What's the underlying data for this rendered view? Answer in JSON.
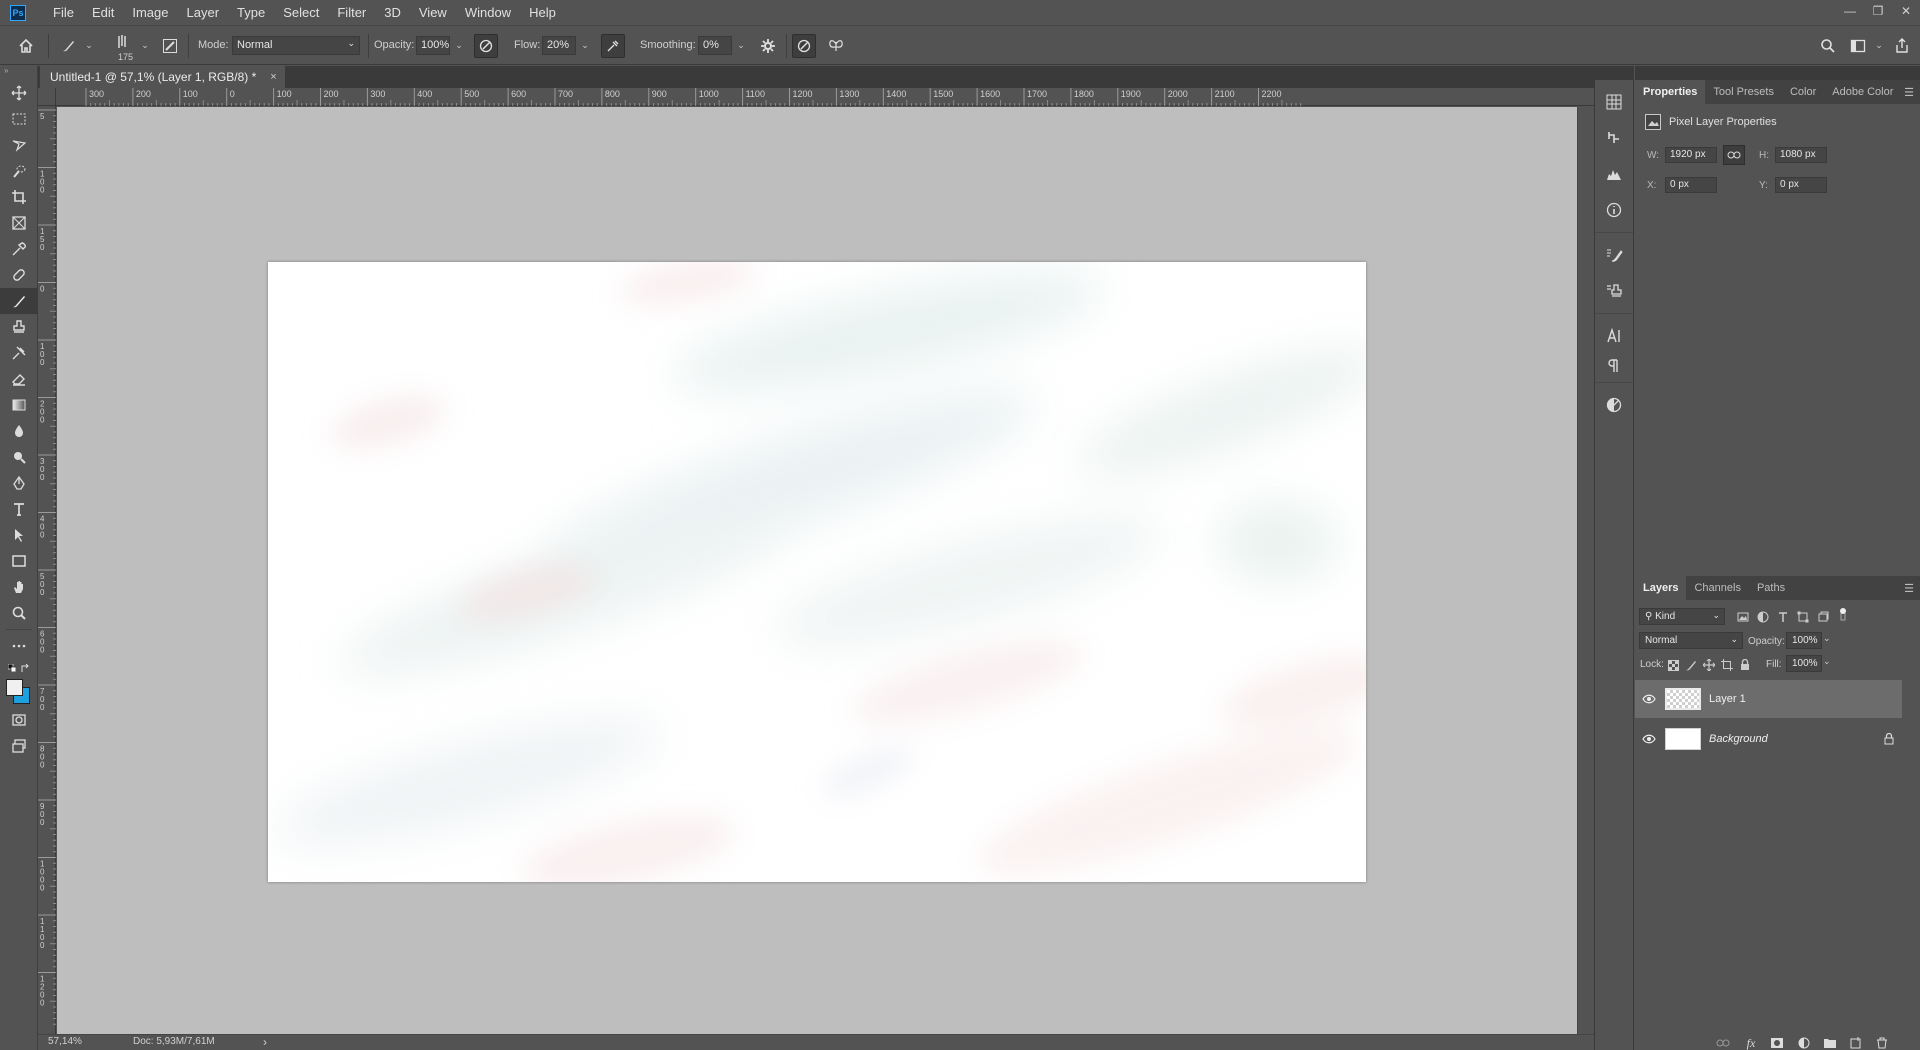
{
  "app": {
    "logo_text": "Ps"
  },
  "menu": [
    "File",
    "Edit",
    "Image",
    "Layer",
    "Type",
    "Select",
    "Filter",
    "3D",
    "View",
    "Window",
    "Help"
  ],
  "window_controls": {
    "minimize": "—",
    "restore": "❐",
    "close": "✕"
  },
  "options": {
    "brush_size": "175",
    "mode_label": "Mode:",
    "mode_value": "Normal",
    "opacity_label": "Opacity:",
    "opacity_value": "100%",
    "flow_label": "Flow:",
    "flow_value": "20%",
    "smoothing_label": "Smoothing:",
    "smoothing_value": "0%"
  },
  "document_tab": {
    "title": "Untitled-1 @ 57,1% (Layer 1, RGB/8) *",
    "close": "×"
  },
  "ruler_h_labels": [
    "300",
    "200",
    "100",
    "0",
    "100",
    "200",
    "300",
    "400",
    "500",
    "600",
    "700",
    "800",
    "900",
    "1000",
    "1100",
    "1200",
    "1300",
    "1400",
    "1500",
    "1600",
    "1700",
    "1800",
    "1900",
    "2000",
    "2100",
    "2200"
  ],
  "ruler_v_labels": [
    "5",
    "1 0 0",
    "1 5 0",
    "0",
    "1 0 0",
    "2 0 0",
    "3 0 0",
    "4 0 0",
    "5 0 0",
    "6 0 0",
    "7 0 0",
    "8 0 0",
    "9 0 0",
    "1 0 0 0",
    "1 1 0 0",
    "1 2 0 0"
  ],
  "status": {
    "zoom": "57,14%",
    "doc": "Doc: 5,93M/7,61M",
    "arrow": "›"
  },
  "properties_panel": {
    "tabs": [
      "Properties",
      "Tool Presets",
      "Color",
      "Adobe Color"
    ],
    "title": "Pixel Layer Properties",
    "w_label": "W:",
    "w_value": "1920 px",
    "h_label": "H:",
    "h_value": "1080 px",
    "x_label": "X:",
    "x_value": "0 px",
    "y_label": "Y:",
    "y_value": "0 px"
  },
  "layers_panel": {
    "tabs": [
      "Layers",
      "Channels",
      "Paths"
    ],
    "filter_kind": "Kind",
    "blend_mode": "Normal",
    "opacity_label": "Opacity:",
    "opacity_value": "100%",
    "lock_label": "Lock:",
    "fill_label": "Fill:",
    "fill_value": "100%",
    "layers": [
      {
        "name": "Layer 1",
        "selected": true,
        "locked": false
      },
      {
        "name": "Background",
        "selected": false,
        "locked": true
      }
    ]
  },
  "colors": {
    "accent": "#31a8ff",
    "background_swatch": "#1ca0e0",
    "foreground_swatch": "#f0f0f0"
  }
}
